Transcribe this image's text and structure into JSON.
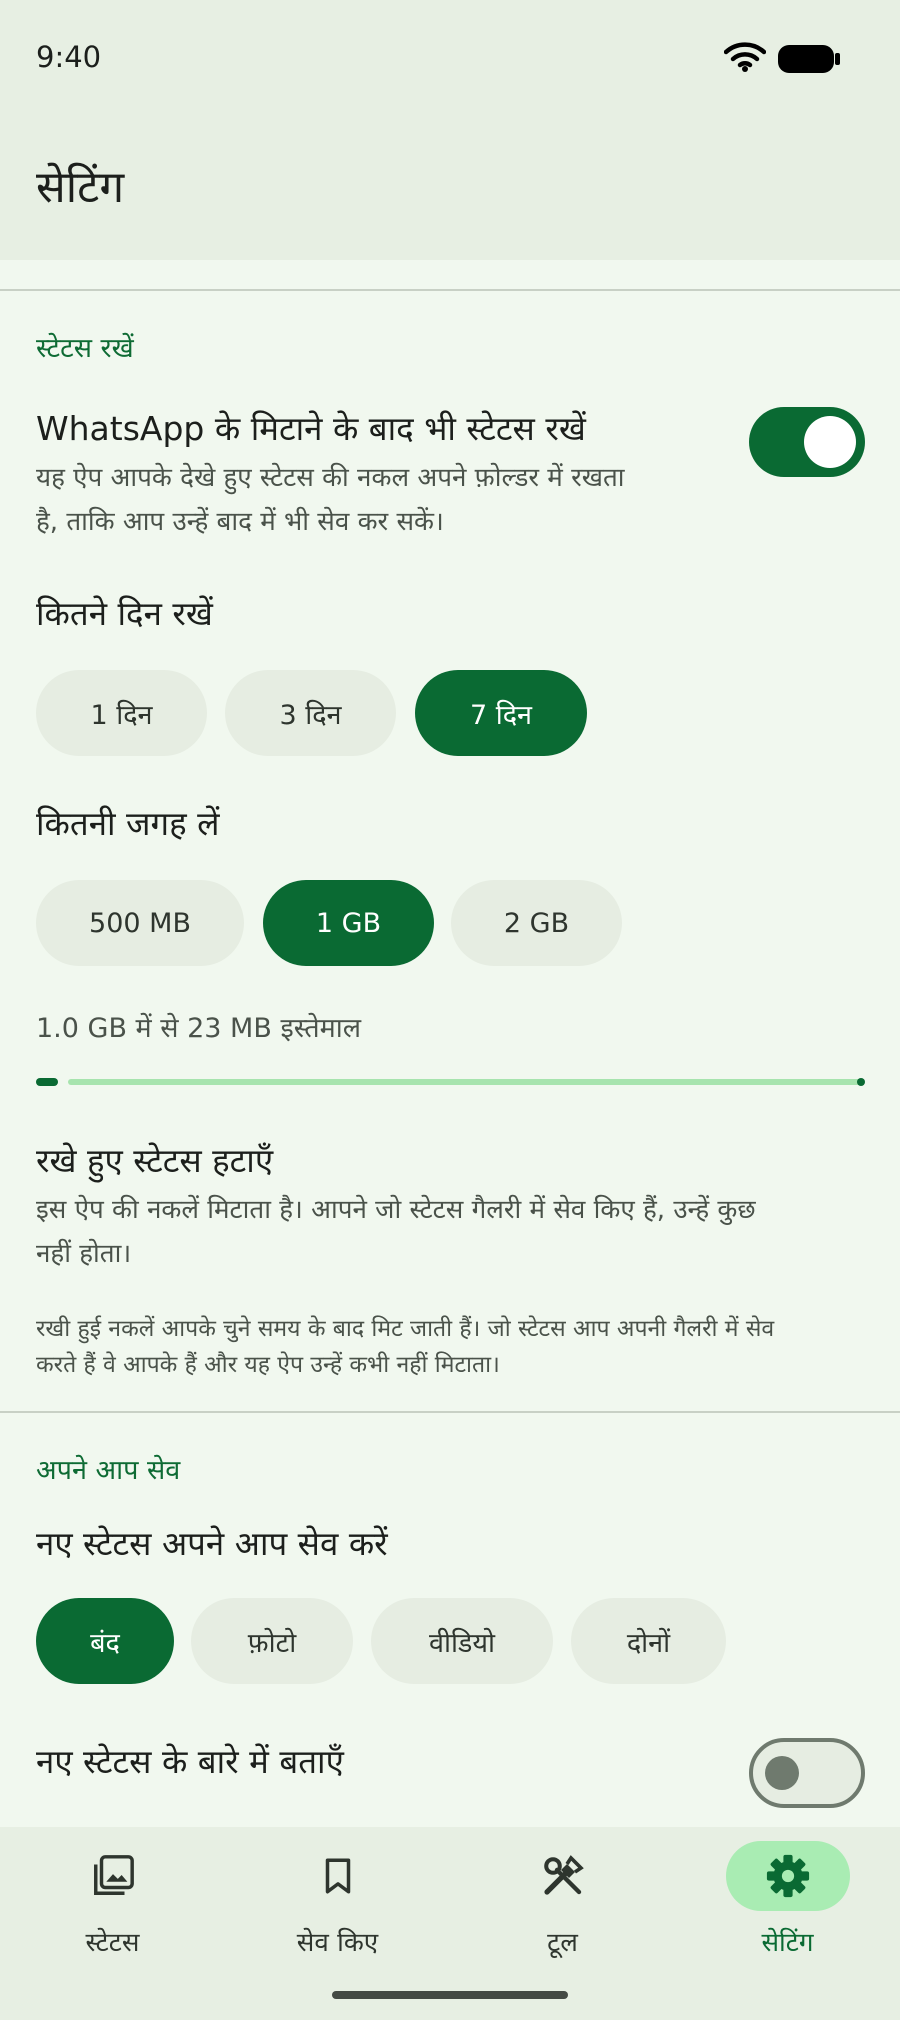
{
  "status_bar": {
    "time": "9:40",
    "wifi_icon": "wifi-icon",
    "battery_icon": "battery-icon"
  },
  "app_bar": {
    "title": "सेटिंग"
  },
  "keep_section": {
    "title": "स्टेटस रखें",
    "keep_toggle": {
      "title": "WhatsApp के मिटाने के बाद भी स्टेटस रखें",
      "desc_line1": "यह ऐप आपके देखे हुए स्टेटस की नकल अपने फ़ोल्डर में रखता",
      "desc_line2": "है, ताकि आप उन्हें बाद में भी सेव कर सकें।",
      "state": "on"
    },
    "days": {
      "label": "कितने दिन रखें",
      "options": [
        "1 दिन",
        "3 दिन",
        "7 दिन"
      ],
      "selected": "7 दिन"
    },
    "space": {
      "label": "कितनी जगह लें",
      "options": [
        "500 MB",
        "1 GB",
        "2 GB"
      ],
      "selected": "1 GB"
    },
    "usage": {
      "text": "1.0 GB में से 23 MB इस्तेमाल",
      "used_fraction": 0.023
    },
    "remove": {
      "title": "रखे हुए स्टेटस हटाएँ",
      "desc_line1": "इस ऐप की नकलें मिटाता है। आपने जो स्टेटस गैलरी में सेव किए हैं, उन्हें कुछ",
      "desc_line2": "नहीं होता।"
    },
    "note_line1": "रखी हुई नकलें आपके चुने समय के बाद मिट जाती हैं। जो स्टेटस आप अपनी गैलरी में सेव",
    "note_line2": "करते हैं वे आपके हैं और यह ऐप उन्हें कभी नहीं मिटाता।"
  },
  "auto_section": {
    "title": "अपने आप सेव",
    "autosave": {
      "label": "नए स्टेटस अपने आप सेव करें",
      "options": [
        "बंद",
        "फ़ोटो",
        "वीडियो",
        "दोनों"
      ],
      "selected": "बंद"
    },
    "notify": {
      "title": "नए स्टेटस के बारे में बताएँ",
      "state": "off"
    }
  },
  "nav": {
    "items": [
      {
        "label": "स्टेटस",
        "icon": "photo-library-icon"
      },
      {
        "label": "सेव किए",
        "icon": "bookmark-icon"
      },
      {
        "label": "टूल",
        "icon": "tools-icon"
      },
      {
        "label": "सेटिंग",
        "icon": "gear-icon"
      }
    ],
    "active": "सेटिंग"
  },
  "colors": {
    "accent": "#0a6a33",
    "accent_light": "#a9ecb3",
    "background": "#f1f8ef",
    "bar_background": "#e7efe3"
  }
}
